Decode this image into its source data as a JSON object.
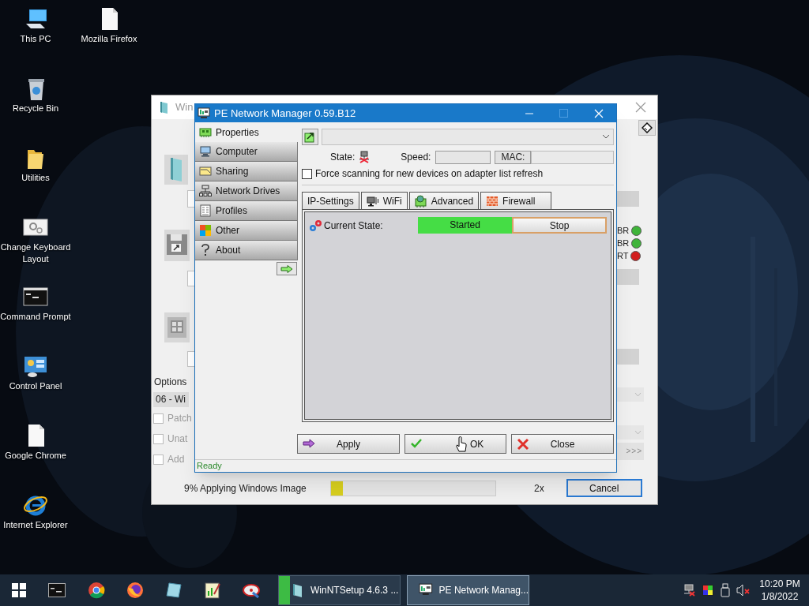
{
  "desktop_icons": [
    {
      "label": "This PC",
      "kind": "computer"
    },
    {
      "label": "Recycle Bin",
      "kind": "recycle-bin"
    },
    {
      "label": "Utilities",
      "kind": "folder"
    },
    {
      "label": "Change Keyboard Layout",
      "kind": "settings-window"
    },
    {
      "label": "Command Prompt",
      "kind": "console"
    },
    {
      "label": "Control Panel",
      "kind": "control-panel"
    },
    {
      "label": "Google Chrome",
      "kind": "file"
    },
    {
      "label": "Internet Explorer",
      "kind": "browser"
    },
    {
      "label": "Mozilla Firefox",
      "kind": "file"
    }
  ],
  "setup_window": {
    "title": "Win",
    "options_label": "Options",
    "edition": "06 - Wi",
    "checkboxes": [
      {
        "label": "Patch",
        "checked": false
      },
      {
        "label": "Unat",
        "checked": false
      },
      {
        "label": "Add",
        "checked": false
      }
    ],
    "indicators": [
      {
        "label": "BR",
        "color": "#3fb43a"
      },
      {
        "label": "BR",
        "color": "#3fb43a"
      },
      {
        "label": "RT",
        "color": "#d21f1f"
      }
    ],
    "more_button": ">>>",
    "progress": {
      "text": "9% Applying Windows Image",
      "level": 0.07
    },
    "speed": "2x",
    "cancel": "Cancel"
  },
  "network_manager": {
    "title": "PE Network Manager 0.59.B12",
    "nav": [
      {
        "label": "Properties",
        "kind": "properties",
        "selected": true
      },
      {
        "label": "Computer",
        "kind": "computer",
        "selected": false
      },
      {
        "label": "Sharing",
        "kind": "sharing",
        "selected": false
      },
      {
        "label": "Network Drives",
        "kind": "drives",
        "selected": false
      },
      {
        "label": "Profiles",
        "kind": "profiles",
        "selected": false
      },
      {
        "label": "Other",
        "kind": "other",
        "selected": false
      },
      {
        "label": "About",
        "kind": "about",
        "selected": false
      }
    ],
    "state_label": "State:",
    "speed_label": "Speed:",
    "mac_label": "MAC:",
    "force_scan": {
      "label": "Force scanning for new devices on adapter list refresh",
      "checked": false
    },
    "tabs": [
      {
        "label": "IP-Settings",
        "kind": "plain",
        "selected": false
      },
      {
        "label": "WiFi",
        "kind": "wifi",
        "selected": true
      },
      {
        "label": "Advanced",
        "kind": "advanced",
        "selected": false
      },
      {
        "label": "Firewall",
        "kind": "firewall",
        "selected": false
      }
    ],
    "current_state_label": "Current State:",
    "status": "Started",
    "stop_button": "Stop",
    "buttons": [
      {
        "label": "Apply",
        "kind": "apply"
      },
      {
        "label": "OK",
        "kind": "ok"
      },
      {
        "label": "Close",
        "kind": "close"
      }
    ],
    "status_bar": "Ready"
  },
  "taskbar": {
    "tasks": [
      {
        "label": "WinNTSetup 4.6.3 ...",
        "kind": "setup",
        "selected": false,
        "level": 0.09
      },
      {
        "label": "PE Network Manag...",
        "kind": "network",
        "selected": true
      }
    ],
    "clock": {
      "time": "10:20 PM",
      "date": "1/8/2022"
    }
  }
}
